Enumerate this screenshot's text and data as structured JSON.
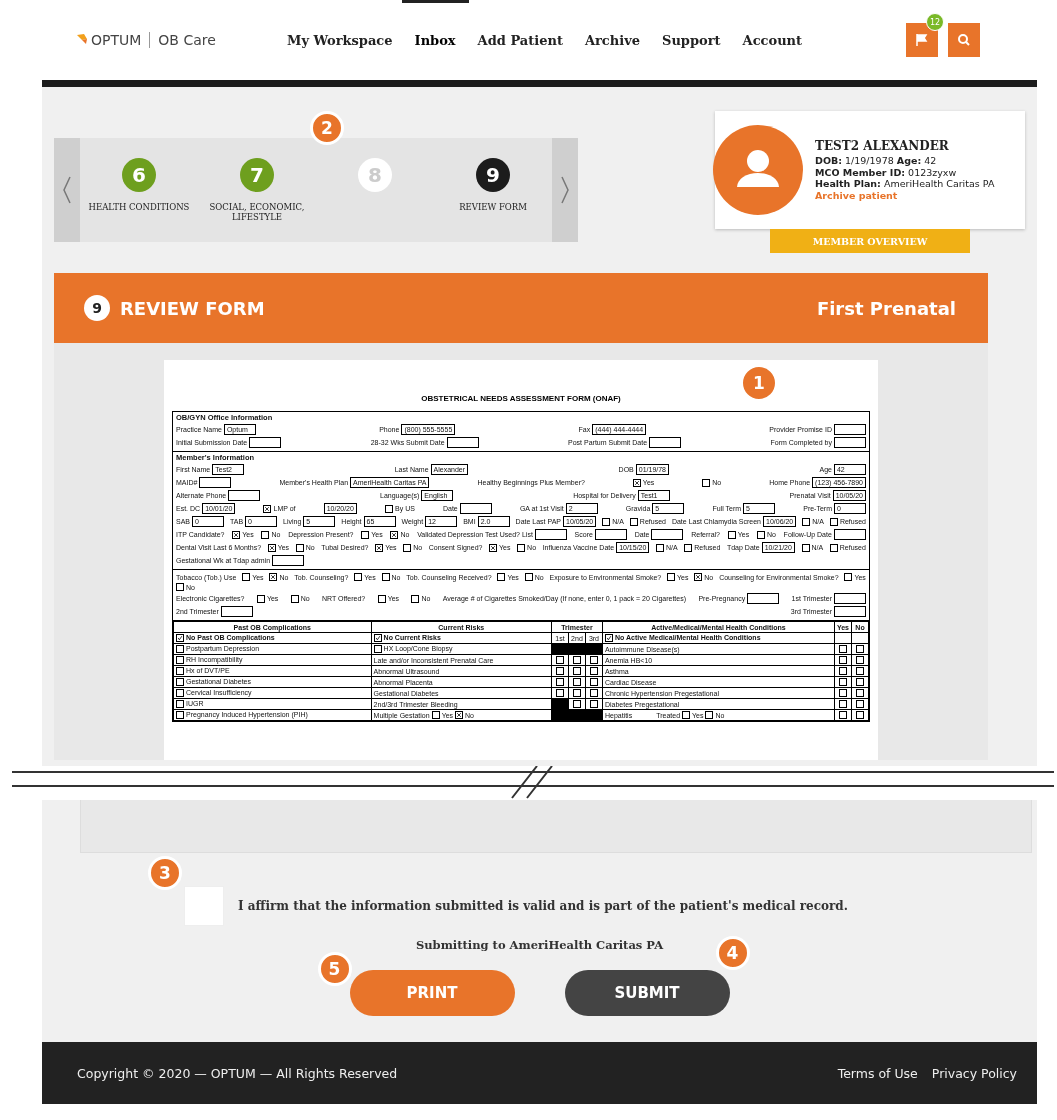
{
  "header": {
    "brand": "OPTUM",
    "product": "OB Care",
    "nav": [
      {
        "label": "My Workspace",
        "selected": false
      },
      {
        "label": "Inbox",
        "selected": true
      },
      {
        "label": "Add Patient",
        "selected": false
      },
      {
        "label": "Archive",
        "selected": false
      },
      {
        "label": "Support",
        "selected": false
      },
      {
        "label": "Account",
        "selected": false
      }
    ],
    "flag_count": "12"
  },
  "steps": {
    "callout": "2",
    "items": [
      {
        "number": "6",
        "label": "HEALTH CONDITIONS",
        "kind": "done"
      },
      {
        "number": "7",
        "label": "SOCIAL, ECONOMIC, LIFESTYLE",
        "kind": "done"
      },
      {
        "number": "8",
        "kind": "disabled"
      },
      {
        "number": "9",
        "label": "REVIEW FORM",
        "kind": "current"
      }
    ]
  },
  "patient": {
    "name": "TEST2 ALEXANDER",
    "details": [
      "**DOB:** 1/19/1978  **Age:** 42",
      "**MCO Member ID:** 0123zyxw",
      "**Health Plan:** AmeriHealth Caritas PA"
    ],
    "archive_link": "Archive patient",
    "overview_button": "MEMBER OVERVIEW"
  },
  "banner": {
    "number": "9",
    "title": "REVIEW FORM",
    "subtitle": "First Prenatal"
  },
  "document": {
    "callout": "1",
    "title": "OBSTETRICAL NEEDS ASSESSMENT FORM (ONAF)",
    "sections": [
      {
        "heading": "OB/GYN Office Information",
        "rows": [
          {
            "items": [
              {
                "kind": "field",
                "label": "Practice Name",
                "value": "Optum"
              },
              {
                "kind": "field",
                "label": "Phone",
                "value": "(800) 555-5555"
              },
              {
                "kind": "field",
                "label": "Fax",
                "value": "(444) 444-4444"
              },
              {
                "kind": "field",
                "label": "Provider Promise ID"
              }
            ]
          },
          {
            "items": [
              {
                "kind": "field",
                "label": "Initial Submission Date"
              },
              {
                "kind": "field",
                "label": "28-32 Wks Submit Date"
              },
              {
                "kind": "field",
                "label": "Post Partum Submit Date"
              },
              {
                "kind": "field",
                "label": "Form Completed by"
              }
            ]
          }
        ]
      },
      {
        "heading": "Member's Information",
        "rows": [
          {
            "items": [
              {
                "kind": "field",
                "label": "First Name",
                "value": "Test2"
              },
              {
                "kind": "field",
                "label": "Last Name",
                "value": "Alexander"
              },
              {
                "kind": "field",
                "label": "DOB",
                "value": "01/19/78"
              },
              {
                "kind": "field",
                "label": "Age",
                "value": "42"
              }
            ]
          },
          {
            "items": [
              {
                "kind": "field",
                "label": "MAID#"
              },
              {
                "kind": "field",
                "label": "Member's Health Plan",
                "value": "AmeriHealth Caritas PA"
              },
              {
                "kind": "text",
                "label": "Healthy Beginnings Plus Member?"
              },
              {
                "kind": "check",
                "label": "Yes",
                "checked": true
              },
              {
                "kind": "check",
                "label": "No",
                "checked": false
              },
              {
                "kind": "field",
                "label": "Home Phone",
                "value": "(123) 456-7890"
              }
            ]
          },
          {
            "items": [
              {
                "kind": "field",
                "label": "Alternate Phone"
              },
              {
                "kind": "field",
                "label": "Language(s)",
                "value": "English"
              },
              {
                "kind": "field",
                "label": "Hospital for Delivery",
                "value": "Test1"
              },
              {
                "kind": "field",
                "label": "Prenatal Visit",
                "value": "10/05/20"
              }
            ]
          },
          {
            "items": [
              {
                "kind": "field",
                "label": "Est. DC",
                "value": "10/01/20"
              },
              {
                "kind": "check",
                "label": "LMP of",
                "checked": true
              },
              {
                "kind": "field",
                "value": "10/20/20"
              },
              {
                "kind": "check",
                "label": "By US",
                "checked": false
              },
              {
                "kind": "field",
                "label": "Date"
              },
              {
                "kind": "field",
                "label": "GA at 1st Visit",
                "value": "2"
              },
              {
                "kind": "field",
                "label": "Gravida",
                "value": "5"
              },
              {
                "kind": "field",
                "label": "Full Term",
                "value": "5"
              },
              {
                "kind": "field",
                "label": "Pre-Term",
                "value": "0"
              }
            ]
          },
          {
            "items": [
              {
                "kind": "field",
                "label": "SAB",
                "value": "0"
              },
              {
                "kind": "field",
                "label": "TAB",
                "value": "0"
              },
              {
                "kind": "field",
                "label": "Living",
                "value": "5"
              },
              {
                "kind": "field",
                "label": "Height",
                "value": "65"
              },
              {
                "kind": "field",
                "label": "Weight",
                "value": "12"
              },
              {
                "kind": "field",
                "label": "BMI",
                "value": "2.0"
              },
              {
                "kind": "field",
                "label": "Date Last PAP",
                "value": "10/05/20"
              },
              {
                "kind": "check",
                "label": "N/A",
                "checked": false
              },
              {
                "kind": "check",
                "label": "Refused",
                "checked": false
              },
              {
                "kind": "field",
                "label": "Date Last Chlamydia Screen",
                "value": "10/06/20"
              },
              {
                "kind": "check",
                "label": "N/A",
                "checked": false
              },
              {
                "kind": "check",
                "label": "Refused",
                "checked": false
              }
            ]
          },
          {
            "items": [
              {
                "kind": "text",
                "label": "ITP Candidate?"
              },
              {
                "kind": "check",
                "label": "Yes",
                "checked": true
              },
              {
                "kind": "check",
                "label": "No",
                "checked": false
              },
              {
                "kind": "text",
                "label": "Depression Present?"
              },
              {
                "kind": "check",
                "label": "Yes",
                "checked": false
              },
              {
                "kind": "check",
                "label": "No",
                "checked": true
              },
              {
                "kind": "field",
                "label": "Validated Depression Test Used? List"
              },
              {
                "kind": "field",
                "label": "Score"
              },
              {
                "kind": "field",
                "label": "Date"
              },
              {
                "kind": "text",
                "label": "Referral?"
              },
              {
                "kind": "check",
                "label": "Yes",
                "checked": false
              },
              {
                "kind": "check",
                "label": "No",
                "checked": false
              },
              {
                "kind": "field",
                "label": "Follow-Up Date"
              }
            ]
          },
          {
            "items": [
              {
                "kind": "text",
                "label": "Dental Visit Last 6 Months?"
              },
              {
                "kind": "check",
                "label": "Yes",
                "checked": true
              },
              {
                "kind": "check",
                "label": "No",
                "checked": false
              },
              {
                "kind": "text",
                "label": "Tubal Desired?"
              },
              {
                "kind": "check",
                "label": "Yes",
                "checked": true
              },
              {
                "kind": "check",
                "label": "No",
                "checked": false
              },
              {
                "kind": "text",
                "label": "Consent Signed?"
              },
              {
                "kind": "check",
                "label": "Yes",
                "checked": true
              },
              {
                "kind": "check",
                "label": "No",
                "checked": false
              },
              {
                "kind": "field",
                "label": "Influenza Vaccine Date",
                "value": "10/15/20"
              },
              {
                "kind": "check",
                "label": "N/A",
                "checked": false
              },
              {
                "kind": "check",
                "label": "Refused",
                "checked": false
              },
              {
                "kind": "field",
                "label": "Tdap Date",
                "value": "10/21/20"
              },
              {
                "kind": "check",
                "label": "N/A",
                "checked": false
              },
              {
                "kind": "check",
                "label": "Refused",
                "checked": false
              },
              {
                "kind": "field",
                "label": "Gestational Wk at Tdap admin"
              }
            ]
          }
        ]
      },
      {
        "rows": [
          {
            "items": [
              {
                "kind": "text",
                "label": "Tobacco (Tob.) Use"
              },
              {
                "kind": "check",
                "label": "Yes",
                "checked": false
              },
              {
                "kind": "check",
                "label": "No",
                "checked": true
              },
              {
                "kind": "text",
                "label": "Tob. Counseling?"
              },
              {
                "kind": "check",
                "label": "Yes",
                "checked": false
              },
              {
                "kind": "check",
                "label": "No",
                "checked": false
              },
              {
                "kind": "text",
                "label": "Tob. Counseling Received?"
              },
              {
                "kind": "check",
                "label": "Yes",
                "checked": false
              },
              {
                "kind": "check",
                "label": "No",
                "checked": false
              },
              {
                "kind": "text",
                "label": "Exposure to Environmental Smoke?"
              },
              {
                "kind": "check",
                "label": "Yes",
                "checked": false
              },
              {
                "kind": "check",
                "label": "No",
                "checked": true
              },
              {
                "kind": "text",
                "label": "Counseling for Environmental Smoke?"
              },
              {
                "kind": "check",
                "label": "Yes",
                "checked": false
              },
              {
                "kind": "check",
                "label": "No",
                "checked": false
              }
            ]
          },
          {
            "items": [
              {
                "kind": "text",
                "label": "Electronic Cigarettes?"
              },
              {
                "kind": "check",
                "label": "Yes",
                "checked": false
              },
              {
                "kind": "check",
                "label": "No",
                "checked": false
              },
              {
                "kind": "text",
                "label": "NRT Offered?"
              },
              {
                "kind": "check",
                "label": "Yes",
                "checked": false
              },
              {
                "kind": "check",
                "label": "No",
                "checked": false
              },
              {
                "kind": "text",
                "label": "Average # of Cigarettes Smoked/Day (If none, enter 0, 1 pack = 20 Cigarettes)"
              },
              {
                "kind": "field",
                "label": "Pre-Pregnancy"
              },
              {
                "kind": "field",
                "label": "1st Trimester"
              },
              {
                "kind": "field",
                "label": "2nd Trimester"
              },
              {
                "kind": "field",
                "label": "3rd Trimester"
              }
            ]
          }
        ]
      }
    ],
    "table": {
      "columns": [
        "Past OB Complications",
        "Current Risks",
        "Trimester",
        "Active/Medical/Mental Health Conditions",
        "Yes",
        "No"
      ],
      "none_row": {
        "complications": "No Past OB Complications",
        "complications_checked": true,
        "risks": "No Current Risks",
        "risks_checked": true,
        "trimesters": [
          "1st",
          "2nd",
          "3rd"
        ],
        "conditions": "No Active Medical/Mental Health Conditions",
        "conditions_checked": true
      },
      "rows": [
        {
          "complication": "Postpartum Depression",
          "complication_checked": false,
          "risk": {
            "kind": "check",
            "text": "HX Loop/Cone Biopsy",
            "checked": false
          },
          "trimester": [
            false,
            false,
            false
          ],
          "condition": "Autoimmune Disease(s)",
          "yes": false,
          "no": false
        },
        {
          "complication": "RH Incompatibility",
          "complication_checked": false,
          "risk": {
            "kind": "text",
            "text": "Late and/or Inconsistent Prenatal Care"
          },
          "trimester": [
            true,
            true,
            true
          ],
          "condition": "Anemia HB<10",
          "yes": false,
          "no": false
        },
        {
          "complication": "Hx of DVT/PE",
          "complication_checked": false,
          "risk": {
            "kind": "text",
            "text": "Abnormal Ultrasound"
          },
          "trimester": [
            true,
            true,
            true
          ],
          "condition": "Asthma",
          "yes": false,
          "no": false
        },
        {
          "complication": "Gestational Diabetes",
          "complication_checked": false,
          "risk": {
            "kind": "text",
            "text": "Abnormal Placenta"
          },
          "trimester": [
            true,
            true,
            true
          ],
          "condition": "Cardiac Disease",
          "yes": false,
          "no": false
        },
        {
          "complication": "Cervical Insufficiency",
          "complication_checked": false,
          "risk": {
            "kind": "text",
            "text": "Gestational Diabetes"
          },
          "trimester": [
            true,
            true,
            true
          ],
          "condition": "Chronic Hypertension Pregestational",
          "yes": false,
          "no": false
        },
        {
          "complication": "IUGR",
          "complication_checked": false,
          "risk": {
            "kind": "text",
            "text": "2nd/3rd Trimester Bleeding"
          },
          "trimester": [
            false,
            true,
            true
          ],
          "condition": "Diabetes Pregestational",
          "yes": false,
          "no": false
        },
        {
          "complication": "Pregnancy Induced Hypertension (PIH)",
          "complication_checked": false,
          "risk": {
            "kind": "yesno",
            "text": "Multiple Gestation",
            "options": [
              {
                "label": "Yes",
                "checked": false
              },
              {
                "label": "No",
                "checked": true
              }
            ]
          },
          "trimester": [
            false,
            false,
            false
          ],
          "condition": "Hepatitis",
          "treated": {
            "label": "Treated",
            "options": [
              {
                "label": "Yes",
                "checked": false
              },
              {
                "label": "No",
                "checked": false
              }
            ]
          },
          "yes": false,
          "no": false
        }
      ]
    }
  },
  "affirm": {
    "callout": "3",
    "checked": false,
    "text": "I affirm that the information submitted is valid and is part of the patient's medical record."
  },
  "submitting": "Submitting to AmeriHealth Caritas PA",
  "print_button": {
    "label": "PRINT",
    "callout": "5"
  },
  "submit_button": {
    "label": "SUBMIT",
    "callout": "4"
  },
  "footer": {
    "copyright": "Copyright © 2020 — OPTUM — All Rights Reserved",
    "links": [
      "Terms of Use",
      "Privacy Policy"
    ]
  }
}
